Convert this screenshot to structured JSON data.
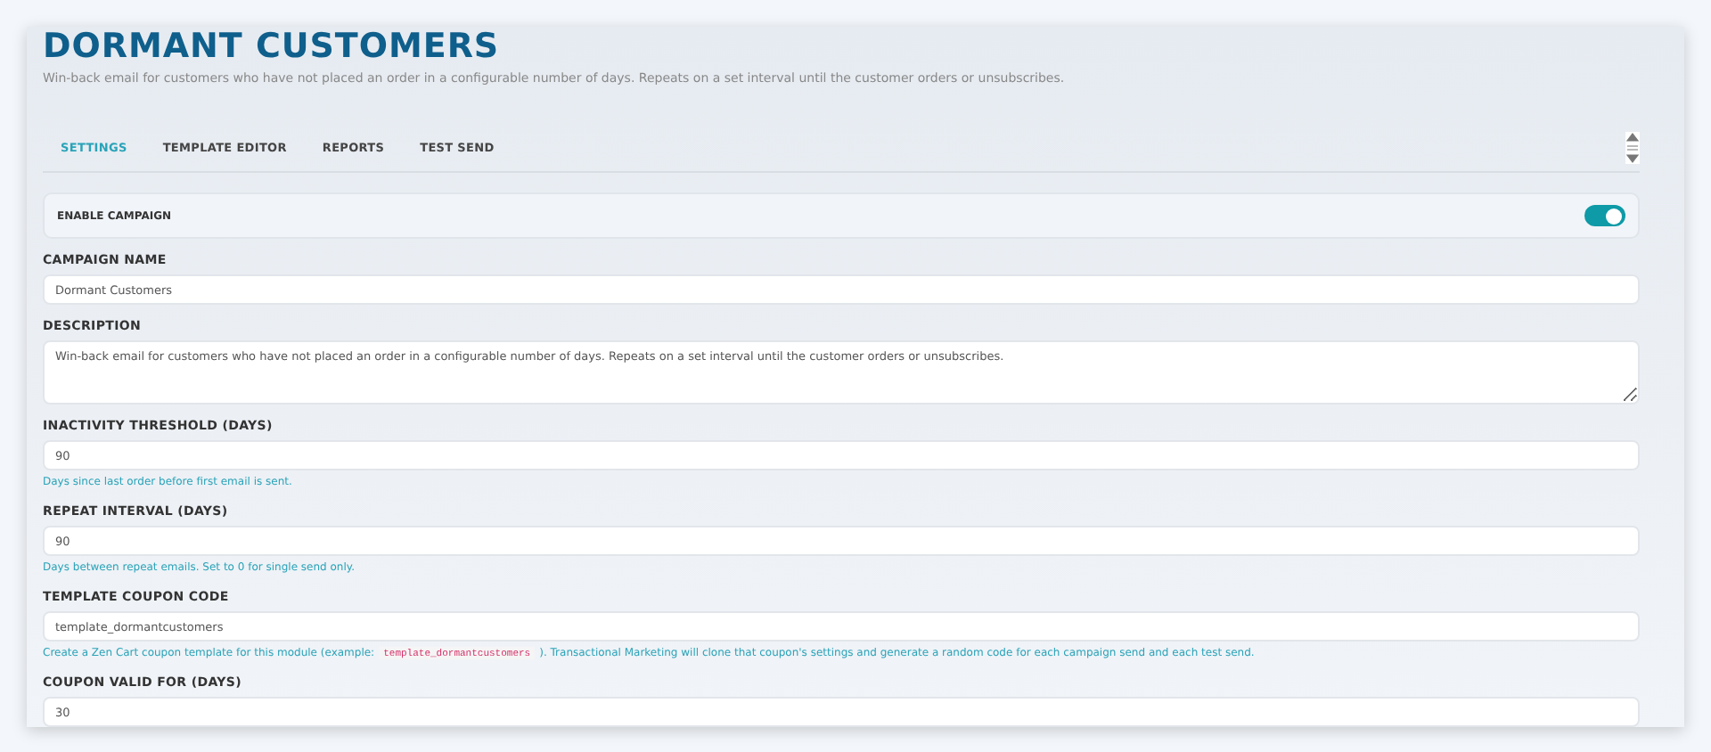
{
  "page": {
    "title": "DORMANT CUSTOMERS",
    "subtitle": "Win-back email for customers who have not placed an order in a configurable number of days. Repeats on a set interval until the customer orders or unsubscribes."
  },
  "tabs": [
    {
      "label": "SETTINGS",
      "selected": true
    },
    {
      "label": "TEMPLATE EDITOR",
      "selected": false
    },
    {
      "label": "REPORTS",
      "selected": false
    },
    {
      "label": "TEST SEND",
      "selected": false
    }
  ],
  "enable_campaign": {
    "label": "ENABLE CAMPAIGN",
    "on": true
  },
  "fields": [
    {
      "kind": "input",
      "label": "CAMPAIGN NAME",
      "value": "Dormant Customers"
    },
    {
      "kind": "textarea",
      "label": "DESCRIPTION",
      "value": "Win-back email for customers who have not placed an order in a configurable number of days. Repeats on a set interval until the customer orders or unsubscribes."
    },
    {
      "kind": "input",
      "label": "INACTIVITY THRESHOLD (DAYS)",
      "value": "90",
      "help": [
        {
          "kind": "text",
          "text": "Days since last order before first email is sent."
        }
      ]
    },
    {
      "kind": "input",
      "label": "REPEAT INTERVAL (DAYS)",
      "value": "90",
      "help": [
        {
          "kind": "text",
          "text": "Days between repeat emails. Set to 0 for single send only."
        }
      ]
    },
    {
      "kind": "input",
      "label": "TEMPLATE COUPON CODE",
      "value": "template_dormantcustomers",
      "help": [
        {
          "kind": "text",
          "text": "Create a Zen Cart coupon template for this module (example:"
        },
        {
          "kind": "code",
          "text": "template_dormantcustomers"
        },
        {
          "kind": "text",
          "text": "). Transactional Marketing will clone that coupon's settings and generate a random code for each campaign send and each test send."
        }
      ]
    },
    {
      "kind": "input",
      "label": "COUPON VALID FOR (DAYS)",
      "value": "30"
    }
  ]
}
